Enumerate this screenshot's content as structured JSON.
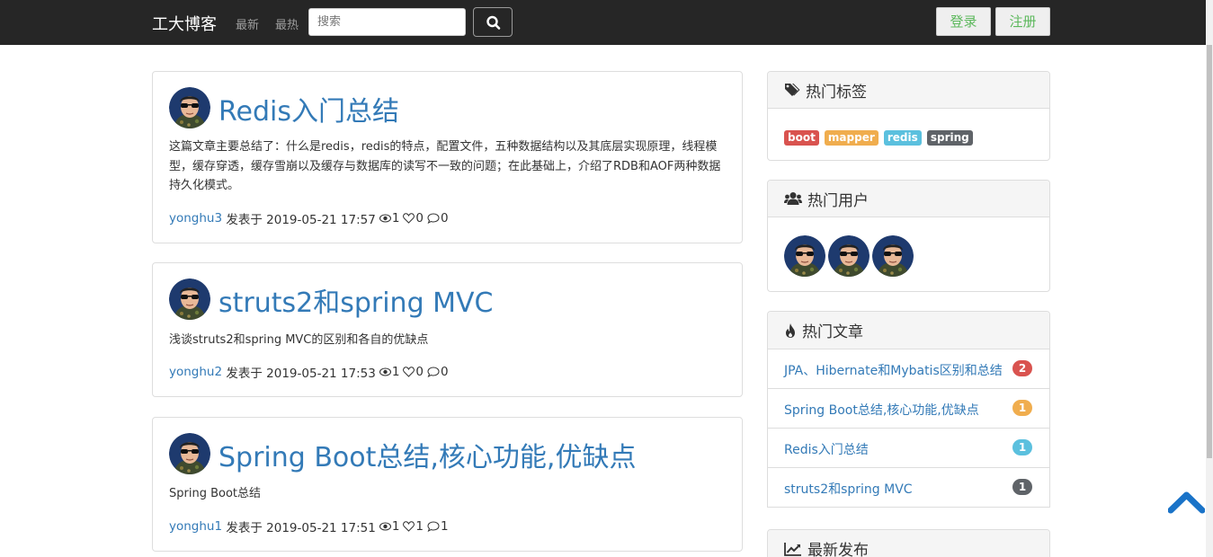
{
  "navbar": {
    "brand": "工大博客",
    "links": [
      "最新",
      "最热"
    ],
    "search_placeholder": "搜索",
    "login": "登录",
    "register": "注册"
  },
  "posts": [
    {
      "title": "Redis入门总结",
      "summary": "这篇文章主要总结了：什么是redis，redis的特点，配置文件，五种数据结构以及其底层实现原理，线程模型，缓存穿透，缓存雪崩以及缓存与数据库的读写不一致的问题；在此基础上，介绍了RDB和AOF两种数据持久化模式。",
      "author": "yonghu3",
      "published": "发表于 2019-05-21 17:57",
      "views": "1",
      "likes": "0",
      "comments": "0"
    },
    {
      "title": "struts2和spring MVC",
      "summary": "浅谈struts2和spring MVC的区别和各自的优缺点",
      "author": "yonghu2",
      "published": "发表于 2019-05-21 17:53",
      "views": "1",
      "likes": "0",
      "comments": "0"
    },
    {
      "title": "Spring Boot总结,核心功能,优缺点",
      "summary": "Spring Boot总结",
      "author": "yonghu1",
      "published": "发表于 2019-05-21 17:51",
      "views": "1",
      "likes": "1",
      "comments": "1"
    }
  ],
  "sidebar": {
    "hot_tags": {
      "title": "热门标签",
      "tags": [
        {
          "label": "boot",
          "color": "#d9534f"
        },
        {
          "label": "mapper",
          "color": "#f0ad4e"
        },
        {
          "label": "redis",
          "color": "#5bc0de"
        },
        {
          "label": "spring",
          "color": "#5f6368"
        }
      ]
    },
    "hot_users": {
      "title": "热门用户"
    },
    "hot_articles": {
      "title": "热门文章",
      "items": [
        {
          "label": "JPA、Hibernate和Mybatis区别和总结",
          "count": "2",
          "color": "#d9534f"
        },
        {
          "label": "Spring Boot总结,核心功能,优缺点",
          "count": "1",
          "color": "#f0ad4e"
        },
        {
          "label": "Redis入门总结",
          "count": "1",
          "color": "#5bc0de"
        },
        {
          "label": "struts2和spring MVC",
          "count": "1",
          "color": "#5f6368"
        }
      ]
    },
    "latest": {
      "title": "最新发布"
    }
  },
  "colors": {
    "link": "#337ab7",
    "navbar": "#262626",
    "success": "#5cb85c"
  }
}
